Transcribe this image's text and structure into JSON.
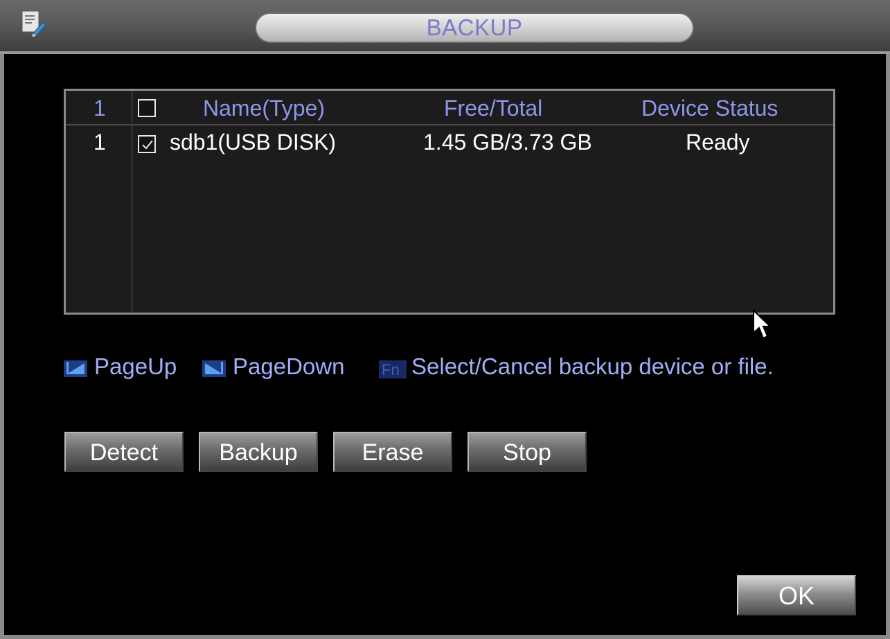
{
  "window": {
    "title": "BACKUP",
    "app_icon": "pen-edit-icon"
  },
  "table": {
    "headers": {
      "index": "1",
      "checkbox_checked": false,
      "name": "Name(Type)",
      "free_total": "Free/Total",
      "status": "Device Status"
    },
    "rows": [
      {
        "index": "1",
        "checked": true,
        "name": "sdb1(USB DISK)",
        "free_total": "1.45 GB/3.73 GB",
        "status": "Ready"
      }
    ]
  },
  "hints": {
    "page_up_icon": "page-up-icon",
    "page_up": "PageUp",
    "page_down_icon": "page-down-icon",
    "page_down": "PageDown",
    "fn_icon": "fn-key-icon",
    "fn_key": "Fn",
    "fn_text": "Select/Cancel backup device or file."
  },
  "buttons": {
    "detect": "Detect",
    "backup": "Backup",
    "erase": "Erase",
    "stop": "Stop",
    "ok": "OK"
  },
  "colors": {
    "header_text": "#8f96ea",
    "title_text": "#7a7ac8",
    "hint_text": "#a5adf8",
    "panel_bg": "#1c1c1c",
    "window_bg": "#000000"
  }
}
